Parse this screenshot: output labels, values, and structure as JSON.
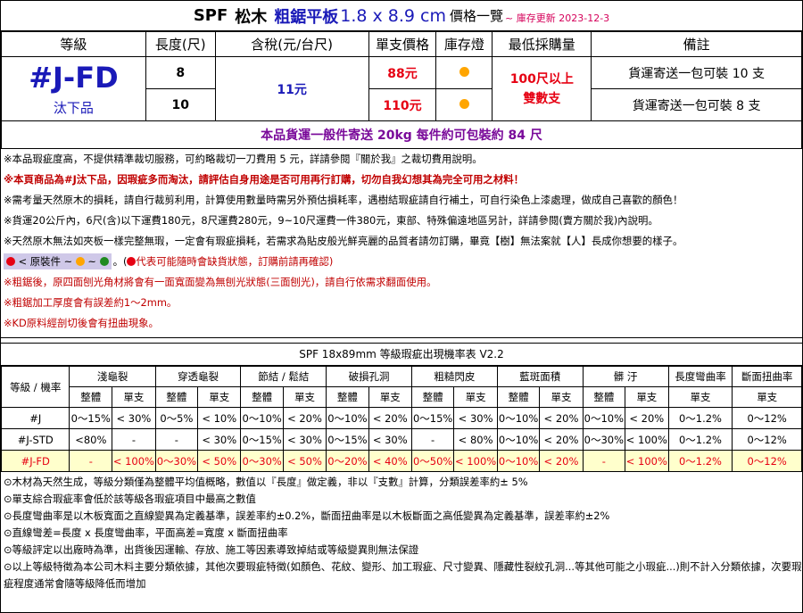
{
  "title": {
    "brand": "SPF",
    "wood": "松木",
    "product": "粗鋸平板",
    "dims": "1.8 x 8.9 cm",
    "suffix": "價格一覽",
    "update": "~ 庫存更新 2023-12-3"
  },
  "product_table": {
    "headers": [
      "等級",
      "長度(尺)",
      "含稅(元/台尺)",
      "單支價格",
      "庫存燈",
      "最低採購量",
      "備註"
    ],
    "grade": "#J-FD",
    "grade_sub": "汰下品",
    "tax_price": "11元",
    "min_purchase_line1": "100尺以上",
    "min_purchase_line2": "雙數支",
    "rows": [
      {
        "length": "8",
        "unit_price": "88元",
        "note": "貨運寄送一包可裝 10 支"
      },
      {
        "length": "10",
        "unit_price": "110元",
        "note": "貨運寄送一包可裝 8 支"
      }
    ],
    "stock_color": "#ffa500",
    "shipping": "本品貨運一般件寄送 20kg 每件約可包裝約 84 尺"
  },
  "notes": {
    "n1": "※本品瑕疵度高，不提供精準裁切服務，可約略裁切一刀費用 5 元，詳請參閱『關於我』之裁切費用說明。",
    "n2": "※本頁商品為#J汰下品，因瑕疵多而淘汰，請評估自身用途是否可用再行訂購，切勿自我幻想其為完全可用之材料！",
    "n3": "※需考量天然原木的損耗，請自行裁剪利用，計算使用數量時需另外預估損耗率，遇樹結瑕疵請自行補土，可自行染色上漆處理，做成自己喜歡的顏色！",
    "n4": "※貨運20公斤內，6尺(含)以下運費180元，8尺運費280元，9~10尺運費一件380元，東部、特殊偏遠地區另計，詳請參閱(賣方關於我)內說明。",
    "n5": "※天然原木無法如夾板一樣完整無瑕，一定會有瑕疵損耗，若需求為貼皮般光鮮亮麗的品質者請勿訂購，畢竟【樹】無法案就【人】長成你想要的樣子。",
    "legend_text": "< 原裝件  ~",
    "legend_sep": "~",
    "legend_red_note": "代表可能隨時會缺貨狀態，訂購前請再確認)",
    "legend_open": "。(",
    "n7": "※粗鋸後，原四面刨光角材將會有一面寬面變為無刨光狀態(三面刨光)，請自行依需求翻面使用。",
    "n8": "※粗鋸加工厚度會有誤差約1～2mm。",
    "n9": "※KD原料經剖切後會有扭曲現象。"
  },
  "defect_table": {
    "title": "SPF 18x89mm 等級瑕疵出現機率表 V2.2",
    "corner": "等級 / 機率",
    "groups": [
      "淺龜裂",
      "穿透龜裂",
      "節結 / 鬆結",
      "破損孔洞",
      "粗糙閃皮",
      "藍斑面積",
      "髒 汙",
      "長度彎曲率",
      "斷面扭曲率"
    ],
    "sub_whole": "整體",
    "sub_single": "單支",
    "rows": [
      {
        "grade": "#J",
        "cells": [
          "0～15%",
          "< 30%",
          "0～5%",
          "< 10%",
          "0～10%",
          "< 20%",
          "0～10%",
          "< 20%",
          "0～15%",
          "< 30%",
          "0～10%",
          "< 20%",
          "0～10%",
          "< 20%",
          "0～1.2%",
          "0～12%"
        ]
      },
      {
        "grade": "#J-STD",
        "cells": [
          "<80%",
          "-",
          "-",
          "< 30%",
          "0～15%",
          "< 30%",
          "0～15%",
          "< 30%",
          "-",
          "< 80%",
          "0～10%",
          "< 20%",
          "0～30%",
          "< 100%",
          "0～1.2%",
          "0～12%"
        ]
      },
      {
        "grade": "#J-FD",
        "cells": [
          "-",
          "< 100%",
          "0～30%",
          "< 50%",
          "0～30%",
          "< 50%",
          "0～20%",
          "< 40%",
          "0～50%",
          "< 100%",
          "0～10%",
          "< 20%",
          "-",
          "< 100%",
          "0～1.2%",
          "0～12%"
        ]
      }
    ]
  },
  "footer": {
    "f1": "⊙木材為天然生成，等級分類僅為整體平均值概略，數值以『長度』做定義，非以『支數』計算，分類誤差率約± 5%",
    "f2": "⊙單支綜合瑕疵率會低於該等級各瑕疵項目中最高之數值",
    "f3": "⊙長度彎曲率是以木板寬面之直線變異為定義基準，誤差率約±0.2%，斷面扭曲率是以木板斷面之高低變異為定義基準，誤差率約±2%",
    "f4": "⊙直線彎差=長度 x 長度彎曲率，平面高差=寬度 x 斷面扭曲率",
    "f5": "⊙等級評定以出廠時為準，出貨後因運輸、存放、施工等因素導致掉結或等級變異則無法保證",
    "f6": "⊙以上等級特徵為本公司木料主要分類依據，其他次要瑕疵特徵(如顏色、花紋、變形、加工瑕疵、尺寸變異、隱藏性裂紋孔洞...等其他可能之小瑕疵...)則不計入分類依據，次要瑕疵程度通常會隨等級降低而增加"
  },
  "colors": {
    "blue": "#1a1ab8",
    "red": "#e60012",
    "purple": "#7a0a9a",
    "legend_bg": "#cfc8e8",
    "fd_row": "#ffffcc"
  }
}
